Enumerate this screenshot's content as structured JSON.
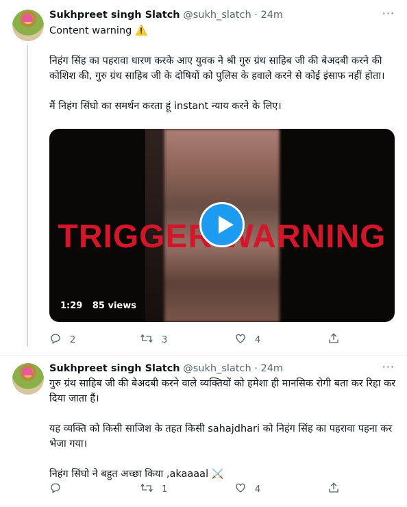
{
  "tweet1": {
    "name": "Sukhpreet singh Slatch",
    "handle": "@sukh_slatch",
    "time": "· 24m",
    "more": "···",
    "warning": "Content warning ⚠️",
    "para1": "निहंग सिंह का पहरावा धारण करके आए युवक ने श्री गुरु ग्रंथ साहिब जी की बेअदबी करने की कोशिश की, गुरु ग्रंथ साहिब जी के दोषियों को पुलिस के हवाले करने से कोई इंसाफ नहीं होता।",
    "para2": "मैं निहंग सिंघो का समर्थन करता हूं instant न्याय करने के लिए।",
    "video": {
      "overlay_text": "TRIGGER WARNING",
      "duration": "1:29",
      "views": "85 views"
    },
    "replies": "2",
    "retweets": "3",
    "likes": "4"
  },
  "tweet2": {
    "name": "Sukhpreet singh Slatch",
    "handle": "@sukh_slatch",
    "time": "· 24m",
    "more": "···",
    "para1": "गुरु ग्रंथ साहिब जी की बेअदबी करने वाले व्यक्तियों को हमेशा ही मानसिक रोगी बता  कर रिहा कर दिया जाता हैं।",
    "para2": "यह व्यक्ति को किसी साजिश के तहत किसी sahajdhari को निहंग सिंह का पहरावा पहना कर भेजा गया।",
    "para3": "निहंग सिंघो ने बहुत अच्छा किया ,akaaaal ⚔️",
    "replies": "",
    "retweets": "1",
    "likes": "4"
  },
  "icons": [
    "reply-icon",
    "retweet-icon",
    "like-icon",
    "share-icon",
    "play-icon",
    "more-icon"
  ],
  "colors": {
    "accent": "#1d9bf0",
    "trigger_red": "#d4162a",
    "secondary_text": "#536471"
  }
}
